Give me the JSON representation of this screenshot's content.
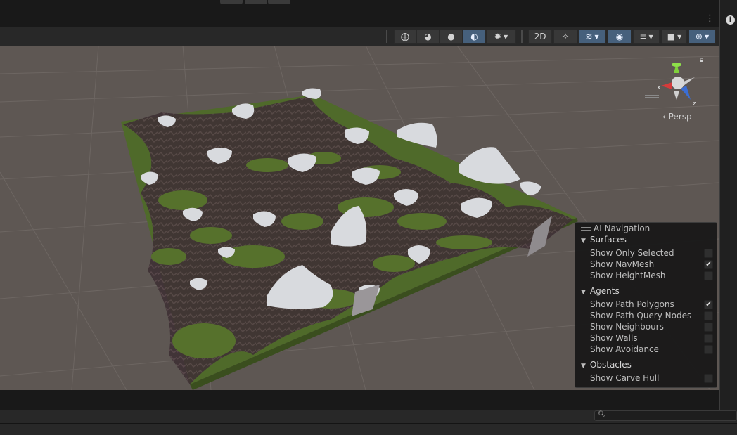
{
  "scene_toolbar": {
    "buttons": [
      {
        "name": "wireframe-globe-icon",
        "glyph": "⨁"
      },
      {
        "name": "shaded-wireframe-icon",
        "glyph": "◕"
      },
      {
        "name": "shaded-sphere-icon",
        "glyph": "●"
      },
      {
        "name": "render-mode-icon",
        "glyph": "◐"
      },
      {
        "name": "debug-draw-icon",
        "glyph": "✹"
      },
      {
        "name": "2d-toggle-label",
        "glyph": "2D"
      },
      {
        "name": "lighting-toggle-icon",
        "glyph": "✧"
      },
      {
        "name": "gizmo-layers-icon",
        "glyph": "≋"
      },
      {
        "name": "visibility-eye-icon",
        "glyph": "◉"
      },
      {
        "name": "layers-icon",
        "glyph": "≡"
      },
      {
        "name": "camera-icon",
        "glyph": "■"
      },
      {
        "name": "gizmos-icon",
        "glyph": "⊕"
      }
    ]
  },
  "gizmo": {
    "label": "Persp",
    "x_axis": "x",
    "z_axis": "z",
    "colors": {
      "x": "#d43b3b",
      "y": "#7fd13b",
      "z": "#3b6ed4"
    }
  },
  "ai_navigation": {
    "title": "AI Navigation",
    "sections": [
      {
        "label": "Surfaces",
        "items": [
          {
            "label": "Show Only Selected",
            "checked": false
          },
          {
            "label": "Show NavMesh",
            "checked": true
          },
          {
            "label": "Show HeightMesh",
            "checked": false
          }
        ]
      },
      {
        "label": "Agents",
        "items": [
          {
            "label": "Show Path Polygons",
            "checked": true
          },
          {
            "label": "Show Path Query Nodes",
            "checked": false
          },
          {
            "label": "Show Neighbours",
            "checked": false
          },
          {
            "label": "Show Walls",
            "checked": false
          },
          {
            "label": "Show Avoidance",
            "checked": false
          }
        ]
      },
      {
        "label": "Obstacles",
        "items": [
          {
            "label": "Show Carve Hull",
            "checked": false
          }
        ]
      }
    ]
  },
  "colors": {
    "viewport_bg": "#5e5753",
    "terrain_grass": "#4f6a2a",
    "terrain_rock": "#3e3034",
    "terrain_snow": "#d8dade",
    "active_button": "#46607c"
  }
}
